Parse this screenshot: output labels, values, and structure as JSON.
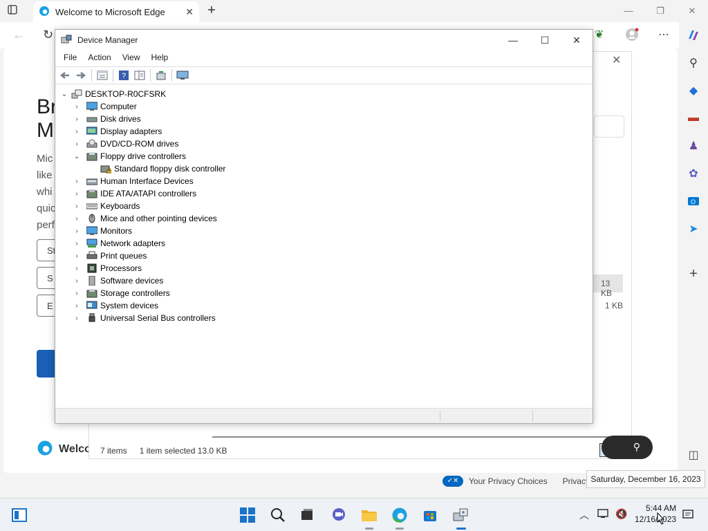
{
  "browser": {
    "tab_title": "Welcome to Microsoft Edge",
    "new_tab": "+",
    "welcome_heading_1": "Br",
    "welcome_heading_2": "M",
    "welcome_body": [
      "Mic",
      "like",
      "whi",
      "quic",
      "perf"
    ],
    "buttons": [
      "St",
      "S",
      "E"
    ],
    "footer_logo_text": "Welco",
    "privacy_choices": "Your Privacy Choices",
    "privacy_link": "Privacy"
  },
  "explorer": {
    "status_items": "7 items",
    "status_selected": "1 item selected",
    "status_size": "13.0 KB",
    "size_row1": "13 KB",
    "size_row2": "1 KB"
  },
  "device_manager": {
    "title": "Device Manager",
    "menu": [
      "File",
      "Action",
      "View",
      "Help"
    ],
    "root": "DESKTOP-R0CFSRK",
    "categories": [
      {
        "label": "Computer",
        "expanded": false,
        "icon": "computer"
      },
      {
        "label": "Disk drives",
        "expanded": false,
        "icon": "disk"
      },
      {
        "label": "Display adapters",
        "expanded": false,
        "icon": "display"
      },
      {
        "label": "DVD/CD-ROM drives",
        "expanded": false,
        "icon": "dvd"
      },
      {
        "label": "Floppy drive controllers",
        "expanded": true,
        "icon": "floppy"
      },
      {
        "label": "Standard floppy disk controller",
        "child": true,
        "icon": "warning-device"
      },
      {
        "label": "Human Interface Devices",
        "expanded": false,
        "icon": "hid"
      },
      {
        "label": "IDE ATA/ATAPI controllers",
        "expanded": false,
        "icon": "ide"
      },
      {
        "label": "Keyboards",
        "expanded": false,
        "icon": "keyboard"
      },
      {
        "label": "Mice and other pointing devices",
        "expanded": false,
        "icon": "mouse"
      },
      {
        "label": "Monitors",
        "expanded": false,
        "icon": "monitor"
      },
      {
        "label": "Network adapters",
        "expanded": false,
        "icon": "network"
      },
      {
        "label": "Print queues",
        "expanded": false,
        "icon": "printer"
      },
      {
        "label": "Processors",
        "expanded": false,
        "icon": "processor"
      },
      {
        "label": "Software devices",
        "expanded": false,
        "icon": "software"
      },
      {
        "label": "Storage controllers",
        "expanded": false,
        "icon": "storage"
      },
      {
        "label": "System devices",
        "expanded": false,
        "icon": "system"
      },
      {
        "label": "Universal Serial Bus controllers",
        "expanded": false,
        "icon": "usb"
      }
    ]
  },
  "tray": {
    "tooltip": "Saturday, December 16, 2023",
    "time": "5:44 AM",
    "date": "12/16/2023"
  },
  "colors": {
    "accent": "#0067c0",
    "edge_blue": "#1a5fb4",
    "warning": "#f2c12e"
  }
}
